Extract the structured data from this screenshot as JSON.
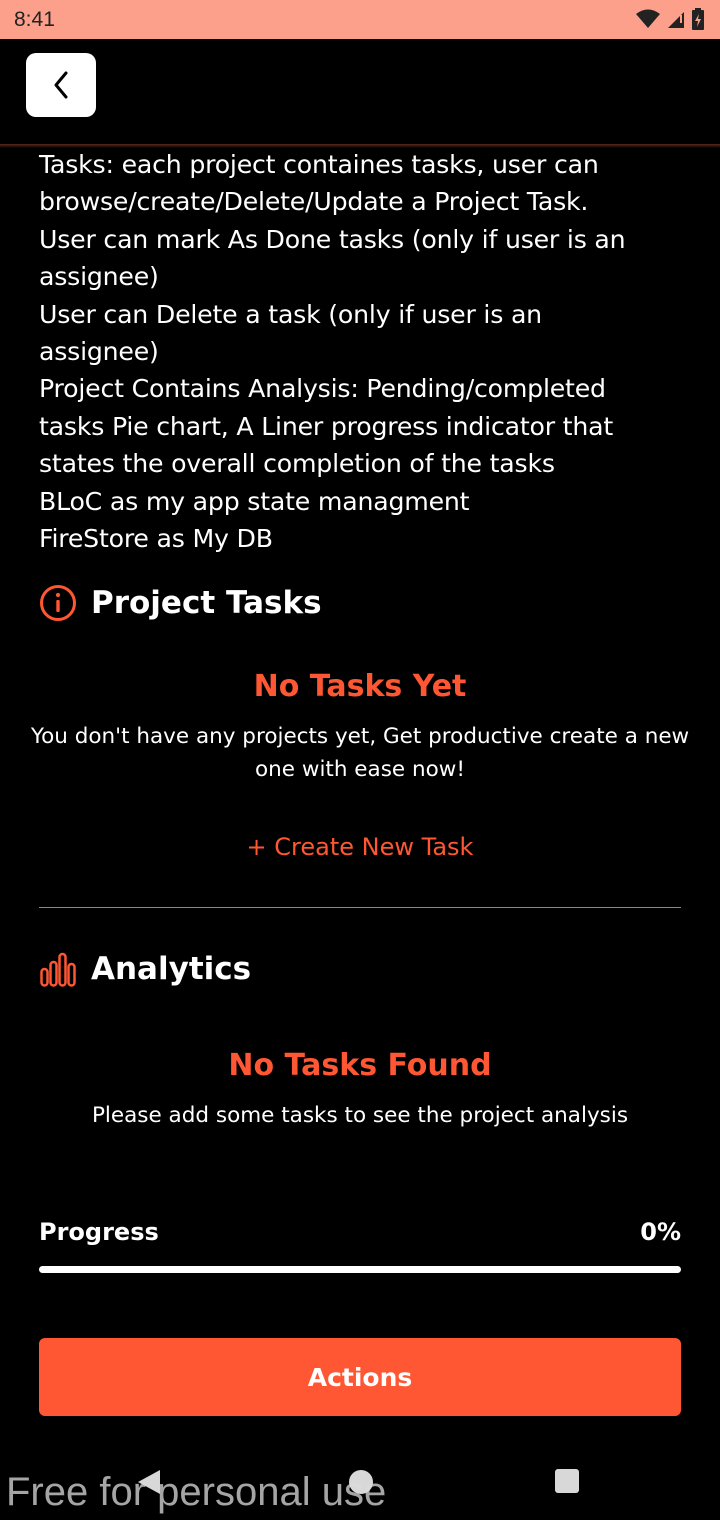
{
  "status_bar": {
    "time": "8:41"
  },
  "description_lines": [
    "Tasks: each project containes tasks, user can",
    "browse/create/Delete/Update a Project Task.",
    "User can mark As Done tasks (only if user is an",
    "assignee)",
    "User can Delete a task (only if user is an",
    "assignee)",
    "Project Contains Analysis: Pending/completed",
    "tasks Pie chart, A Liner progress indicator that",
    "states the overall completion of the tasks",
    "BLoC as my app state managment",
    "FireStore as My DB"
  ],
  "tasks_section": {
    "title": "Project Tasks",
    "empty_title": "No Tasks Yet",
    "empty_message": "You don't have any projects yet, Get productive create a new one with ease now!",
    "create_link": "+ Create New Task"
  },
  "analytics_section": {
    "title": "Analytics",
    "empty_title": "No Tasks Found",
    "empty_message": "Please add some tasks to see the project analysis"
  },
  "progress": {
    "label": "Progress",
    "value_text": "0%",
    "value": 0
  },
  "actions_button": {
    "label": "Actions"
  },
  "watermark": "Free for personal use",
  "colors": {
    "accent": "#ff5733",
    "status_bar": "#fca08c",
    "background": "#000000"
  }
}
